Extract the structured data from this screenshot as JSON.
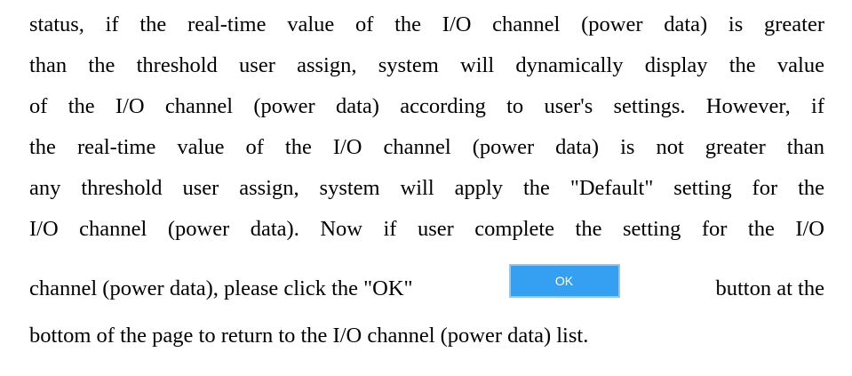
{
  "document": {
    "lines": [
      "status, if the real-time value of the I/O channel (power data) is greater",
      "than the threshold user assign, system will dynamically display the value",
      "of the I/O channel (power data) according to user's settings. However, if",
      "the real-time value of the I/O channel (power data) is not greater than",
      "any threshold user assign, system will apply the \"Default\" setting for the",
      "I/O channel (power data). Now if user complete the setting for the I/O"
    ],
    "ok_line_before": "channel (power data), please click the \"OK\"",
    "ok_button_label": "OK",
    "ok_line_after": "button at the",
    "last_line": "bottom of the page to return to the I/O channel (power data) list."
  },
  "colors": {
    "ok_button_fill": "#35a0f2",
    "ok_button_border": "#8cc9f7",
    "text": "#000000"
  }
}
